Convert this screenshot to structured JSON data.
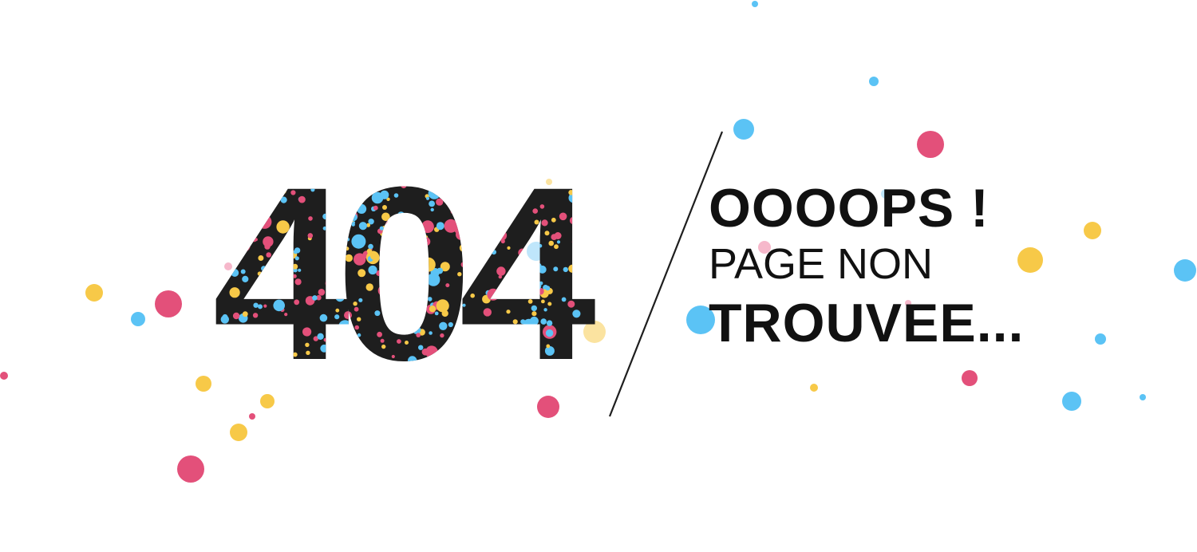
{
  "error": {
    "code": "404",
    "headline": "OOOOPS !",
    "line2": "PAGE NON",
    "line3": "TROUVEE..."
  },
  "colors": {
    "background": "#ffffff",
    "text": "#111111",
    "digit_fill": "#1e1e1e",
    "pink": "#e3507a",
    "yellow": "#f7c948",
    "blue": "#5bc3f5",
    "pale_yellow": "#fbe3a0",
    "pale_pink": "#f6b8cb",
    "pale_blue": "#bfe6fb"
  }
}
